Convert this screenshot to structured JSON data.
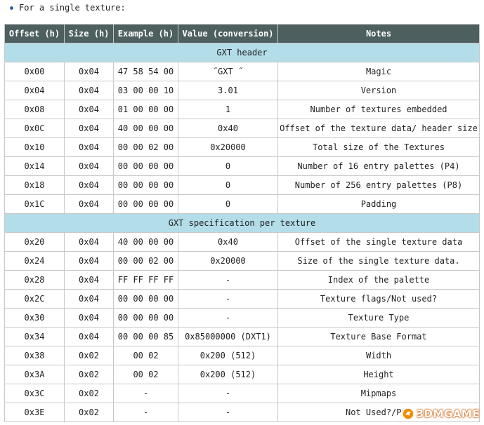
{
  "intro_text": "For a single texture:",
  "headers": [
    "Offset (h)",
    "Size (h)",
    "Example (h)",
    "Value (conversion)",
    "Notes"
  ],
  "sections": [
    {
      "title": "GXT header",
      "rows": [
        [
          "0x00",
          "0x04",
          "47 58 54 00",
          "˝GXT ˝",
          "Magic"
        ],
        [
          "0x04",
          "0x04",
          "03 00 00 10",
          "3.01",
          "Version"
        ],
        [
          "0x08",
          "0x04",
          "01 00 00 00",
          "1",
          "Number of textures embedded"
        ],
        [
          "0x0C",
          "0x04",
          "40 00 00 00",
          "0x40",
          "Offset of the texture data/ header size"
        ],
        [
          "0x10",
          "0x04",
          "00 00 02 00",
          "0x20000",
          "Total size of the Textures"
        ],
        [
          "0x14",
          "0x04",
          "00 00 00 00",
          "0",
          "Number of 16 entry palettes (P4)"
        ],
        [
          "0x18",
          "0x04",
          "00 00 00 00",
          "0",
          "Number of 256 entry palettes (P8)"
        ],
        [
          "0x1C",
          "0x04",
          "00 00 00 00",
          "0",
          "Padding"
        ]
      ]
    },
    {
      "title": "GXT specification per texture",
      "rows": [
        [
          "0x20",
          "0x04",
          "40 00 00 00",
          "0x40",
          "Offset of the single texture data"
        ],
        [
          "0x24",
          "0x04",
          "00 00 02 00",
          "0x20000",
          "Size of the single texture data."
        ],
        [
          "0x28",
          "0x04",
          "FF FF FF FF",
          "-",
          "Index of the palette"
        ],
        [
          "0x2C",
          "0x04",
          "00 00 00 00",
          "-",
          "Texture flags/Not used?"
        ],
        [
          "0x30",
          "0x04",
          "00 00 00 00",
          "-",
          "Texture Type"
        ],
        [
          "0x34",
          "0x04",
          "00 00 00 85",
          "0x85000000 (DXT1)",
          "Texture Base Format"
        ],
        [
          "0x38",
          "0x02",
          "00 02",
          "0x200 (512)",
          "Width"
        ],
        [
          "0x3A",
          "0x02",
          "00 02",
          "0x200 (512)",
          "Height"
        ],
        [
          "0x3C",
          "0x02",
          "-",
          "-",
          "Mipmaps"
        ],
        [
          "0x3E",
          "0x02",
          "-",
          "-",
          "Not Used?/Pad"
        ]
      ]
    }
  ],
  "watermark": {
    "text": "3DMGAME",
    "icon": "3dmgame-logo-icon",
    "color": "#d25a00"
  },
  "colors": {
    "header_bg": "#4d5f5f",
    "section_bg": "#b3dde8",
    "border": "#c8c8c8",
    "bullet": "#2a6aa8"
  }
}
